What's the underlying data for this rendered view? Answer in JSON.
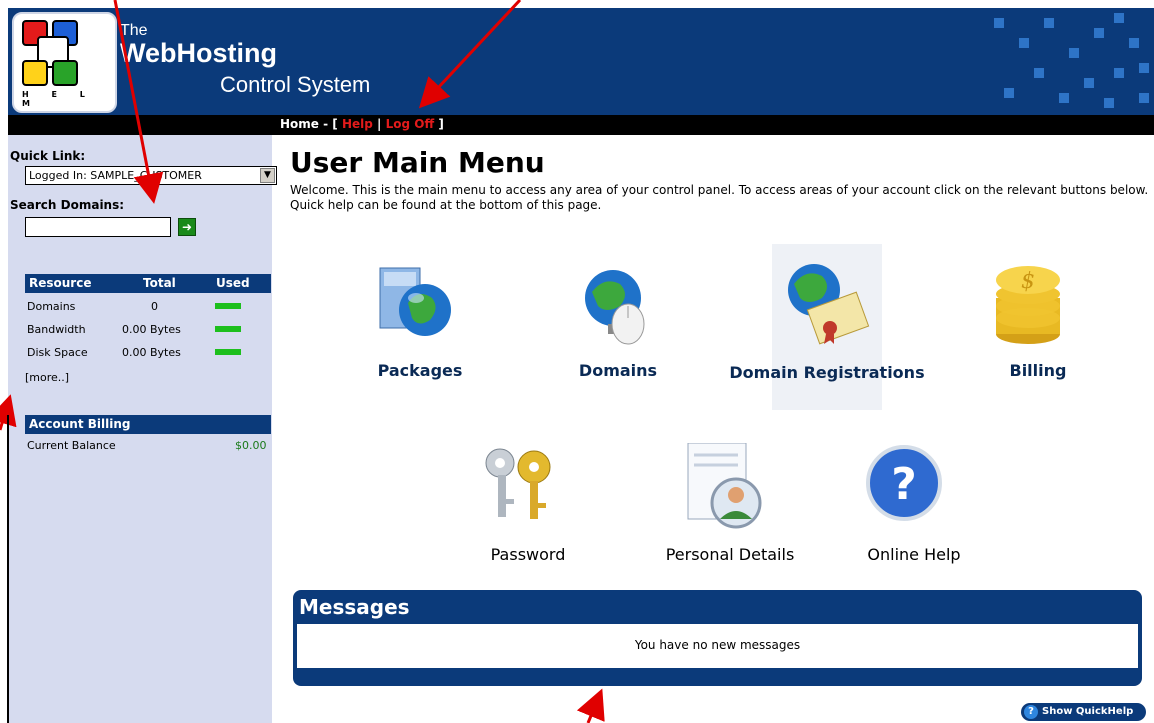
{
  "header": {
    "logo_text": "H E L M",
    "title_the": "The",
    "title_main": "WebHosting",
    "title_sub": "Control System"
  },
  "nav": {
    "home": "Home",
    "sep_open": " - [ ",
    "help": "Help",
    "sep": " | ",
    "logoff": "Log Off",
    "sep_close": " ]"
  },
  "sidebar": {
    "quicklink_label": "Quick Link:",
    "quicklink_value": "Logged In: SAMPLE_CUSTOMER",
    "search_label": "Search Domains:",
    "search_value": "",
    "resources": {
      "headers": [
        "Resource",
        "Total",
        "Used"
      ],
      "rows": [
        {
          "name": "Domains",
          "total": "0"
        },
        {
          "name": "Bandwidth",
          "total": "0.00 Bytes"
        },
        {
          "name": "Disk Space",
          "total": "0.00 Bytes"
        }
      ],
      "more": "[more..]"
    },
    "billing": {
      "header": "Account Billing",
      "label": "Current Balance",
      "value": "$0.00"
    }
  },
  "main": {
    "title": "User Main Menu",
    "intro": "Welcome. This is the main menu to access any area of your control panel. To access areas of your account click on the relevant buttons below. Quick help can be found at the bottom of this page.",
    "tiles": [
      {
        "label": "Packages",
        "icon": "packages-icon"
      },
      {
        "label": "Domains",
        "icon": "domains-icon"
      },
      {
        "label": "Domain Registrations",
        "icon": "domain-registrations-icon"
      },
      {
        "label": "Billing",
        "icon": "billing-icon"
      },
      {
        "label": "Password",
        "icon": "keys-icon"
      },
      {
        "label": "Personal Details",
        "icon": "personal-details-icon"
      },
      {
        "label": "Online Help",
        "icon": "help-icon"
      }
    ]
  },
  "messages": {
    "title": "Messages",
    "text": "You have no new messages"
  },
  "quickhelp": {
    "label": "Show QuickHelp"
  },
  "colors": {
    "brand_blue": "#0b3a7a",
    "sidebar_bg": "#d6dbef",
    "nav_red": "#e21b1b",
    "usage_green": "#1dbf1d"
  }
}
